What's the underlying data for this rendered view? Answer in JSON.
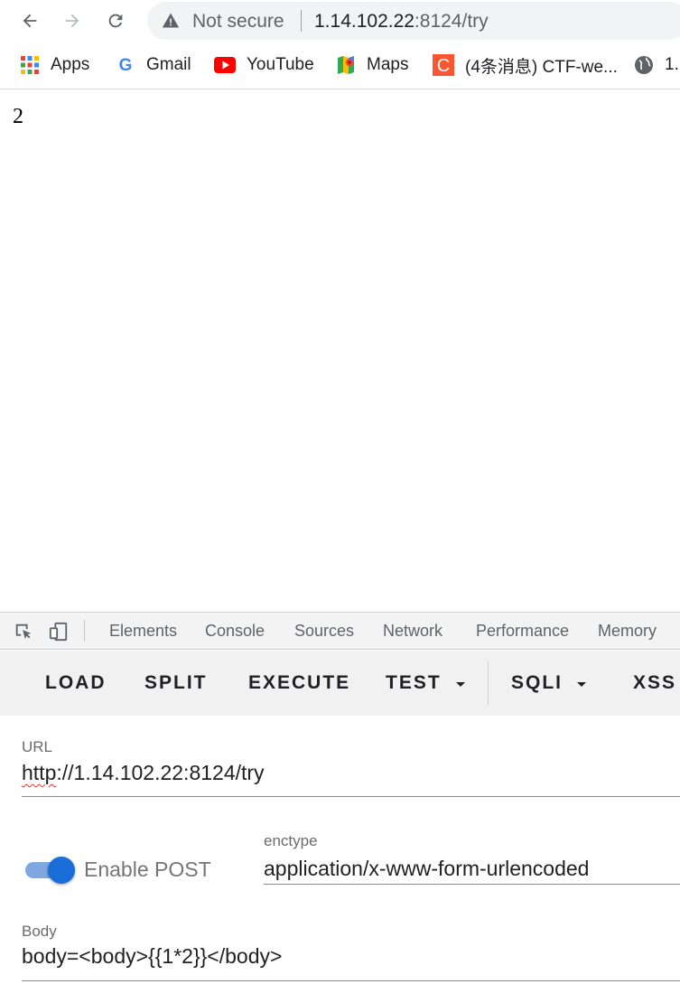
{
  "browser": {
    "security_label": "Not secure",
    "url_host": "1.14.102.22",
    "url_path": ":8124/try",
    "bookmarks": [
      {
        "label": "Apps",
        "icon": "apps-grid-icon"
      },
      {
        "label": "Gmail",
        "icon": "google-g-icon"
      },
      {
        "label": "YouTube",
        "icon": "youtube-icon"
      },
      {
        "label": "Maps",
        "icon": "maps-icon"
      },
      {
        "label": "(4条消息) CTF-we...",
        "icon": "csdn-icon"
      },
      {
        "label": "1.",
        "icon": "globe-icon"
      }
    ]
  },
  "page": {
    "output": "2"
  },
  "devtools": {
    "tabs": [
      "Elements",
      "Console",
      "Sources",
      "Network",
      "Performance",
      "Memory"
    ]
  },
  "hackbar": {
    "buttons": {
      "load": "LOAD",
      "split": "SPLIT",
      "execute": "EXECUTE",
      "test": "TEST",
      "sqli": "SQLI",
      "xss": "XSS"
    },
    "url_label": "URL",
    "url_scheme": "http",
    "url_rest": "://1.14.102.22:8124/try",
    "enable_post_label": "Enable POST",
    "enable_post_on": true,
    "enctype_label": "enctype",
    "enctype_value": "application/x-www-form-urlencoded",
    "body_label": "Body",
    "body_value": "body=<body>{{1*2}}</body>"
  },
  "colors": {
    "accent": "#1a6ed8",
    "omnibox_bg": "#f1f3f4",
    "hackbar_bg": "#f1f1f1"
  }
}
